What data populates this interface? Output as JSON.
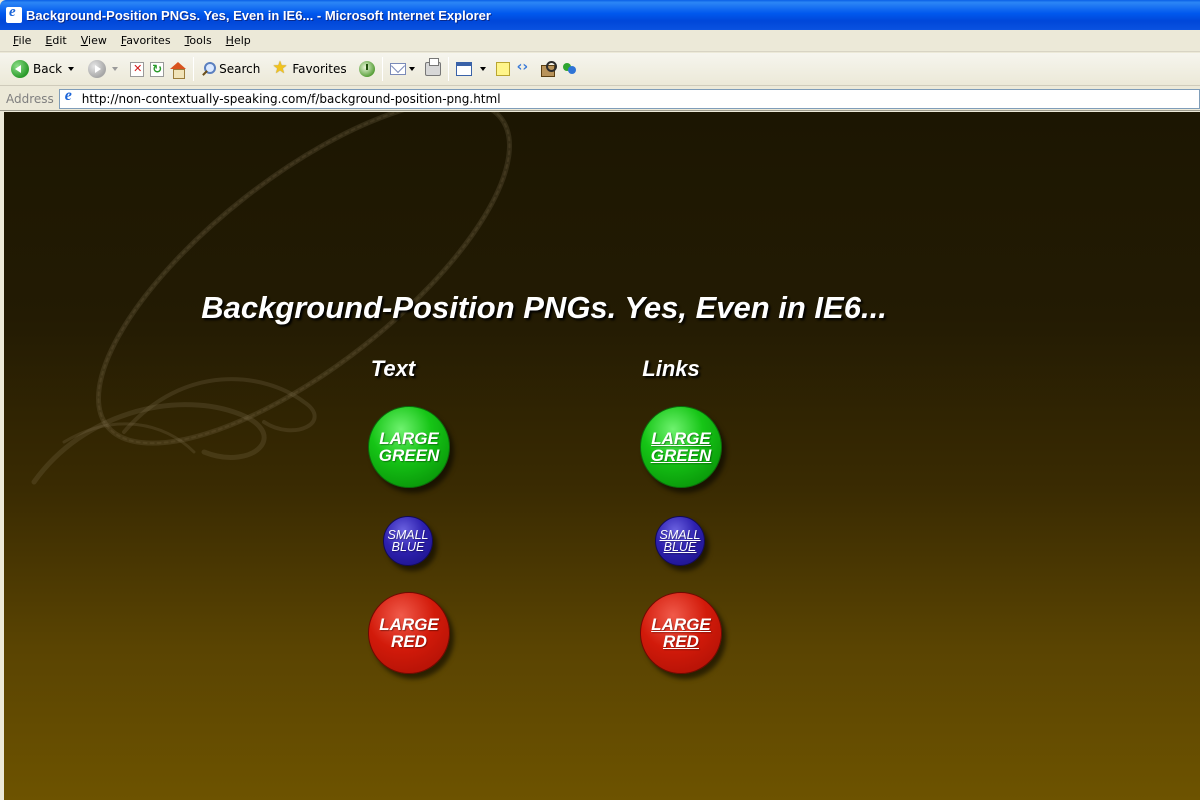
{
  "window": {
    "title": "Background-Position PNGs. Yes, Even in IE6... - Microsoft Internet Explorer"
  },
  "menu": [
    "File",
    "Edit",
    "View",
    "Favorites",
    "Tools",
    "Help"
  ],
  "toolbar": {
    "back_label": "Back",
    "search_label": "Search",
    "favorites_label": "Favorites"
  },
  "address": {
    "label": "Address",
    "url": "http://non-contextually-speaking.com/f/background-position-png.html"
  },
  "page": {
    "heading": "Background-Position PNGs. Yes, Even in IE6...",
    "columns": {
      "text": {
        "title": "Text",
        "buttons": [
          {
            "line1": "LARGE",
            "line2": "GREEN",
            "color": "green",
            "size": "large"
          },
          {
            "line1": "SMALL",
            "line2": "BLUE",
            "color": "blue",
            "size": "small"
          },
          {
            "line1": "LARGE",
            "line2": "RED",
            "color": "red",
            "size": "large"
          }
        ]
      },
      "links": {
        "title": "Links",
        "buttons": [
          {
            "line1": "LARGE",
            "line2": "GREEN",
            "color": "green",
            "size": "large"
          },
          {
            "line1": "SMALL",
            "line2": "BLUE",
            "color": "blue",
            "size": "small"
          },
          {
            "line1": "LARGE",
            "line2": "RED",
            "color": "red",
            "size": "large"
          }
        ]
      }
    }
  },
  "colors": {
    "titlebar": "#0058ee",
    "chrome": "#ece9d8",
    "page_top": "#1c1602",
    "page_bottom": "#6d5300",
    "green": "#16c516",
    "blue": "#2e21b0",
    "red": "#d21a0a"
  }
}
